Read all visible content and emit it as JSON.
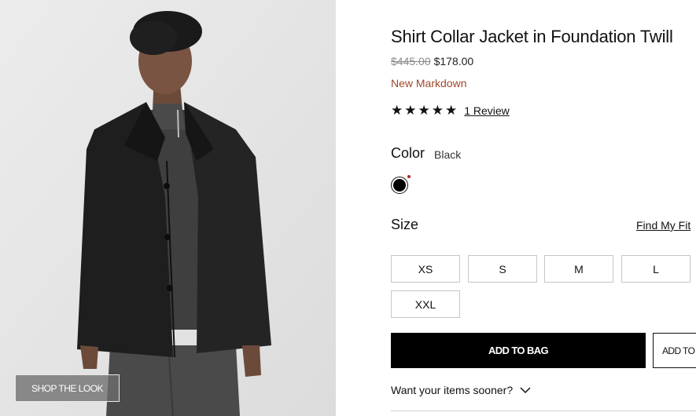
{
  "product": {
    "title": "Shirt Collar Jacket in Foundation Twill",
    "original_price": "$445.00",
    "sale_price": "$178.00",
    "badge": "New Markdown",
    "rating_stars": "★★★★★",
    "rating_value": 5,
    "review_link": "1 Review"
  },
  "image": {
    "shop_the_look_label": "SHOP THE LOOK"
  },
  "color": {
    "label": "Color",
    "selected": "Black",
    "swatch_hex": "#000000"
  },
  "size": {
    "label": "Size",
    "find_my_fit": "Find My Fit",
    "options": [
      "XS",
      "S",
      "M",
      "L",
      "XXL"
    ]
  },
  "actions": {
    "add_to_bag": "ADD TO BAG",
    "add_to_wishlist": "ADD TO"
  },
  "delivery": {
    "prompt": "Want your items sooner?"
  },
  "colors": {
    "markdown": "#a0472c",
    "primary_button": "#000000"
  }
}
